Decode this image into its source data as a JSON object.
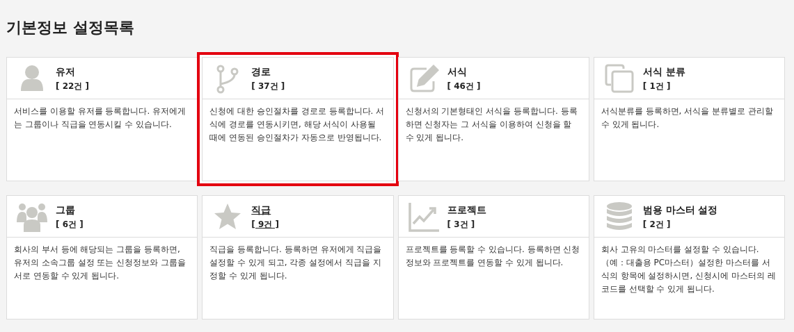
{
  "page_title": "기본정보 설정목록",
  "cards": [
    {
      "kind": "user",
      "title": "유저",
      "count": "[ 22건 ]",
      "description": "서비스를 이용할 유저를 등록합니다. 유저에게는 그룹이나 직급을 연동시킬 수 있습니다.",
      "selected": false,
      "hovered": false
    },
    {
      "kind": "route",
      "title": "경로",
      "count": "[ 37건 ]",
      "description": "신청에 대한 승인절차를 경로로 등록합니다. 서식에 경로를 연동시키면, 해당 서식이 사용될 때에 연동된 승인절차가 자동으로 반영됩니다.",
      "selected": true,
      "hovered": false
    },
    {
      "kind": "form",
      "title": "서식",
      "count": "[ 46건 ]",
      "description": "신청서의 기본형태인 서식을 등록합니다. 등록하면 신청자는 그 서식을 이용하여 신청을 할 수 있게 됩니다.",
      "selected": false,
      "hovered": false
    },
    {
      "kind": "category",
      "title": "서식 분류",
      "count": "[ 1건 ]",
      "description": "서식분류를 등록하면, 서식을 분류별로 관리할 수 있게 됩니다.",
      "selected": false,
      "hovered": false
    },
    {
      "kind": "group",
      "title": "그룹",
      "count": "[ 6건 ]",
      "description": "회사의 부서 등에 해당되는 그룹을 등록하면, 유저의 소속그룹 설정 또는 신청정보와 그룹을 서로 연동할 수 있게 됩니다.",
      "selected": false,
      "hovered": false
    },
    {
      "kind": "rank",
      "title": "직급",
      "count": "[ 9건 ]",
      "description": "직급을 등록합니다. 등록하면 유저에게 직급을 설정할 수 있게 되고, 각종 설정에서 직급을 지정할 수 있게 됩니다.",
      "selected": false,
      "hovered": true
    },
    {
      "kind": "project",
      "title": "프로젝트",
      "count": "[ 3건 ]",
      "description": "프로젝트를 등록할 수 있습니다. 등록하면 신청정보와 프로젝트를 연동할 수 있게 됩니다.",
      "selected": false,
      "hovered": false
    },
    {
      "kind": "master",
      "title": "범용 마스터 설정",
      "count": "[ 2건 ]",
      "description": "회사 고유의 마스터를 설정할 수 있습니다.（예：대출용 PC마스터）설정한 마스터를 서식의 항목에 설정하시면, 신청시에 마스터의 레코드를 선택할 수 있게 됩니다.",
      "selected": false,
      "hovered": false
    }
  ]
}
